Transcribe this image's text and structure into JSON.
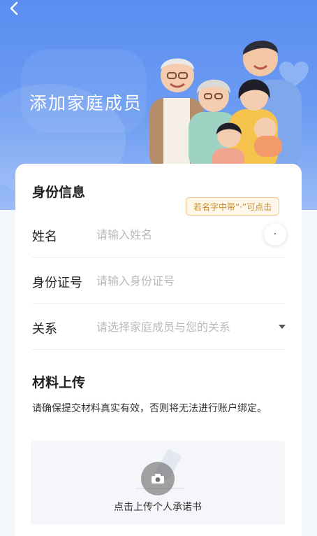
{
  "header": {
    "title": "添加家庭成员"
  },
  "identity_section": {
    "title": "身份信息",
    "tooltip": "若名字中带“·”可点击",
    "dot_button": "·",
    "name": {
      "label": "姓名",
      "placeholder": "请输入姓名"
    },
    "id_number": {
      "label": "身份证号",
      "placeholder": "请输入身份证号"
    },
    "relation": {
      "label": "关系",
      "placeholder": "请选择家庭成员与您的关系"
    }
  },
  "materials_section": {
    "title": "材料上传",
    "notice": "请确保提交材料真实有效，否则将无法进行账户绑定。",
    "upload_label": "点击上传个人承诺书"
  }
}
